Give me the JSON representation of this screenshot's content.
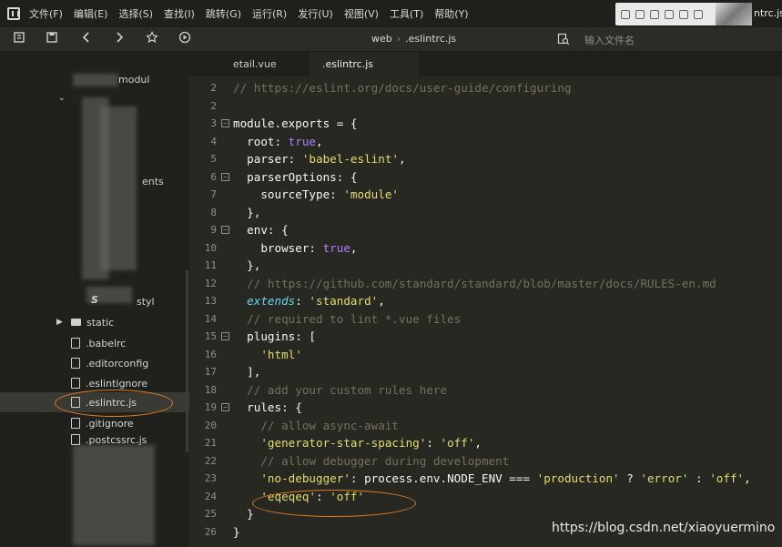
{
  "menu": [
    "文件(F)",
    "编辑(E)",
    "选择(S)",
    "查找(I)",
    "跳转(G)",
    "运行(R)",
    "发行(U)",
    "视图(V)",
    "工具(T)",
    "帮助(Y)"
  ],
  "window_title_tail": "ntrc.js",
  "toolbar": {
    "breadcrumb": [
      "web",
      ".eslintrc.js"
    ],
    "search_placeholder": "输入文件名",
    "icons": [
      "history-icon",
      "save-icon",
      "back-icon",
      "forward-icon",
      "star-icon",
      "run-icon",
      "file-search-icon"
    ]
  },
  "sidebar": {
    "partial_labels": [
      "modul",
      "ents",
      "styl"
    ],
    "items": [
      {
        "label": "static",
        "type": "folder"
      },
      {
        "label": ".babelrc",
        "type": "file"
      },
      {
        "label": ".editorconfig",
        "type": "file"
      },
      {
        "label": ".eslintignore",
        "type": "file"
      },
      {
        "label": ".eslintrc.js",
        "type": "file",
        "selected": true
      },
      {
        "label": ".gitignore",
        "type": "file"
      },
      {
        "label": ".postcssrc.js",
        "type": "file"
      }
    ]
  },
  "tabs": [
    {
      "label": "etail.vue",
      "active": false
    },
    {
      "label": ".eslintrc.js",
      "active": true
    }
  ],
  "editor": {
    "lines": [
      {
        "n": "2",
        "fold": false,
        "tokens": [
          [
            "t-comment",
            "// https://eslint.org/docs/user-guide/configuring"
          ]
        ]
      },
      {
        "n": "2",
        "fold": false,
        "tokens": []
      },
      {
        "n": "3",
        "fold": true,
        "tokens": [
          [
            "t-plain",
            "module.exports = {"
          ]
        ]
      },
      {
        "n": "4",
        "fold": false,
        "tokens": [
          [
            "t-plain",
            "  root: "
          ],
          [
            "t-bool",
            "true"
          ],
          [
            "t-plain",
            ","
          ]
        ]
      },
      {
        "n": "5",
        "fold": false,
        "tokens": [
          [
            "t-plain",
            "  parser: "
          ],
          [
            "t-string",
            "'babel-eslint'"
          ],
          [
            "t-plain",
            ","
          ]
        ]
      },
      {
        "n": "6",
        "fold": true,
        "tokens": [
          [
            "t-plain",
            "  parserOptions: {"
          ]
        ]
      },
      {
        "n": "7",
        "fold": false,
        "tokens": [
          [
            "t-plain",
            "    sourceType: "
          ],
          [
            "t-string",
            "'module'"
          ]
        ]
      },
      {
        "n": "8",
        "fold": false,
        "tokens": [
          [
            "t-plain",
            "  },"
          ]
        ]
      },
      {
        "n": "9",
        "fold": true,
        "tokens": [
          [
            "t-plain",
            "  env: {"
          ]
        ]
      },
      {
        "n": "10",
        "fold": false,
        "tokens": [
          [
            "t-plain",
            "    browser: "
          ],
          [
            "t-bool",
            "true"
          ],
          [
            "t-plain",
            ","
          ]
        ]
      },
      {
        "n": "11",
        "fold": false,
        "tokens": [
          [
            "t-plain",
            "  },"
          ]
        ]
      },
      {
        "n": "12",
        "fold": false,
        "tokens": [
          [
            "t-comment",
            "  // https://github.com/standard/standard/blob/master/docs/RULES-en.md"
          ]
        ]
      },
      {
        "n": "13",
        "fold": false,
        "tokens": [
          [
            "t-plain",
            "  "
          ],
          [
            "t-kw",
            "extends"
          ],
          [
            "t-plain",
            ": "
          ],
          [
            "t-string",
            "'standard'"
          ],
          [
            "t-plain",
            ","
          ]
        ]
      },
      {
        "n": "14",
        "fold": false,
        "tokens": [
          [
            "t-comment",
            "  // required to lint *.vue files"
          ]
        ]
      },
      {
        "n": "15",
        "fold": true,
        "tokens": [
          [
            "t-plain",
            "  plugins: ["
          ]
        ]
      },
      {
        "n": "16",
        "fold": false,
        "tokens": [
          [
            "t-plain",
            "    "
          ],
          [
            "t-string",
            "'html'"
          ]
        ]
      },
      {
        "n": "17",
        "fold": false,
        "tokens": [
          [
            "t-plain",
            "  ],"
          ]
        ]
      },
      {
        "n": "18",
        "fold": false,
        "tokens": [
          [
            "t-comment",
            "  // add your custom rules here"
          ]
        ]
      },
      {
        "n": "19",
        "fold": true,
        "tokens": [
          [
            "t-plain",
            "  rules: {"
          ]
        ]
      },
      {
        "n": "20",
        "fold": false,
        "tokens": [
          [
            "t-comment",
            "    // allow async-await"
          ]
        ]
      },
      {
        "n": "21",
        "fold": false,
        "tokens": [
          [
            "t-plain",
            "    "
          ],
          [
            "t-string",
            "'generator-star-spacing'"
          ],
          [
            "t-plain",
            ": "
          ],
          [
            "t-string",
            "'off'"
          ],
          [
            "t-plain",
            ","
          ]
        ]
      },
      {
        "n": "22",
        "fold": false,
        "tokens": [
          [
            "t-comment",
            "    // allow debugger during development"
          ]
        ]
      },
      {
        "n": "23",
        "fold": false,
        "tokens": [
          [
            "t-plain",
            "    "
          ],
          [
            "t-string",
            "'no-debugger'"
          ],
          [
            "t-plain",
            ": process.env.NODE_ENV === "
          ],
          [
            "t-string",
            "'production'"
          ],
          [
            "t-plain",
            " ? "
          ],
          [
            "t-string",
            "'error'"
          ],
          [
            "t-plain",
            " : "
          ],
          [
            "t-string",
            "'off'"
          ],
          [
            "t-plain",
            ","
          ]
        ]
      },
      {
        "n": "24",
        "fold": false,
        "tokens": [
          [
            "t-plain",
            "    "
          ],
          [
            "t-string",
            "'eqeqeq'"
          ],
          [
            "t-plain",
            ": "
          ],
          [
            "t-string",
            "'off'"
          ]
        ]
      },
      {
        "n": "25",
        "fold": false,
        "tokens": [
          [
            "t-plain",
            "  }"
          ]
        ]
      },
      {
        "n": "26",
        "fold": false,
        "tokens": [
          [
            "t-plain",
            "}"
          ]
        ]
      }
    ]
  },
  "watermark": "https://blog.csdn.net/xiaoyuermino",
  "colors": {
    "annotation": "#e07b26",
    "editor_bg": "#272822",
    "comment": "#75715e",
    "string": "#e6db74",
    "boolean": "#ae81ff"
  }
}
